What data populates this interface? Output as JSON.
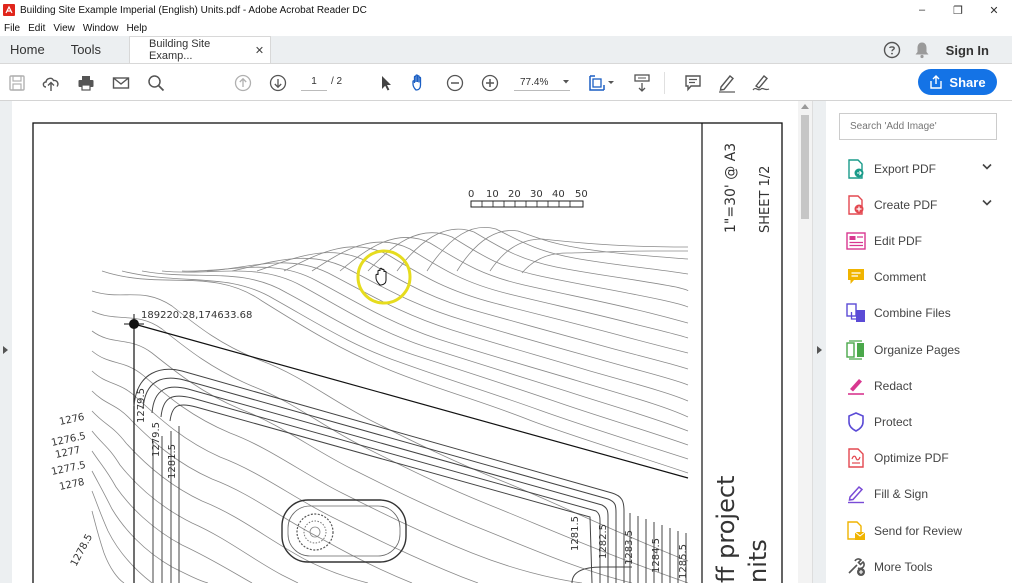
{
  "window": {
    "title": "Building Site Example Imperial (English) Units.pdf - Adobe Acrobat Reader DC",
    "controls": [
      "–",
      "❐",
      "✕"
    ]
  },
  "menu": [
    "File",
    "Edit",
    "View",
    "Window",
    "Help"
  ],
  "tabs": {
    "home": "Home",
    "tools": "Tools",
    "document": "Building Site Examp...",
    "close": "✕"
  },
  "header": {
    "help_icon": "help-icon",
    "bell_icon": "bell-icon",
    "sign_in": "Sign In"
  },
  "toolbar": {
    "page_current": "1",
    "page_total": "/ 2",
    "zoom": "77.4%",
    "share": "Share"
  },
  "search": {
    "placeholder": "Search 'Add Image'"
  },
  "tools": [
    {
      "label": "Export PDF",
      "icon": "export-pdf-icon",
      "color": "#1a9b8a",
      "chevron": true
    },
    {
      "label": "Create PDF",
      "icon": "create-pdf-icon",
      "color": "#e34850",
      "chevron": true
    },
    {
      "label": "Edit PDF",
      "icon": "edit-pdf-icon",
      "color": "#d83790"
    },
    {
      "label": "Comment",
      "icon": "comment-icon",
      "color": "#f0b400"
    },
    {
      "label": "Combine Files",
      "icon": "combine-files-icon",
      "color": "#5b4bd6"
    },
    {
      "label": "Organize Pages",
      "icon": "organize-pages-icon",
      "color": "#4aa84a"
    },
    {
      "label": "Redact",
      "icon": "redact-icon",
      "color": "#d83790"
    },
    {
      "label": "Protect",
      "icon": "protect-icon",
      "color": "#5b4bd6"
    },
    {
      "label": "Optimize PDF",
      "icon": "optimize-pdf-icon",
      "color": "#e34850"
    },
    {
      "label": "Fill & Sign",
      "icon": "fill-sign-icon",
      "color": "#7a4bd6"
    },
    {
      "label": "Send for Review",
      "icon": "send-review-icon",
      "color": "#f0b400"
    },
    {
      "label": "More Tools",
      "icon": "more-tools-icon",
      "color": "#555555"
    }
  ],
  "drawing": {
    "scale_labels": [
      "0",
      "10",
      "20",
      "30",
      "40",
      "50"
    ],
    "scale_text": "1\"=30' @ A3",
    "sheet_text": "SHEET 1/2",
    "coordinate": "189220.28,174633.68",
    "contours_left": [
      "1276",
      "1276.5",
      "1277",
      "1277.5",
      "1278",
      "1278.5"
    ],
    "contours_vertical": [
      "1279.5",
      "1279.5",
      "1281.5"
    ],
    "contours_bottom": [
      "1281.5",
      "1282.5",
      "1283.5",
      "1284.5",
      "1285.5"
    ],
    "title_fragment_1": "ff project",
    "title_fragment_2": "nits"
  },
  "colors": {
    "accent": "#1473e6",
    "cursor_highlight": "#e6dc1e"
  }
}
